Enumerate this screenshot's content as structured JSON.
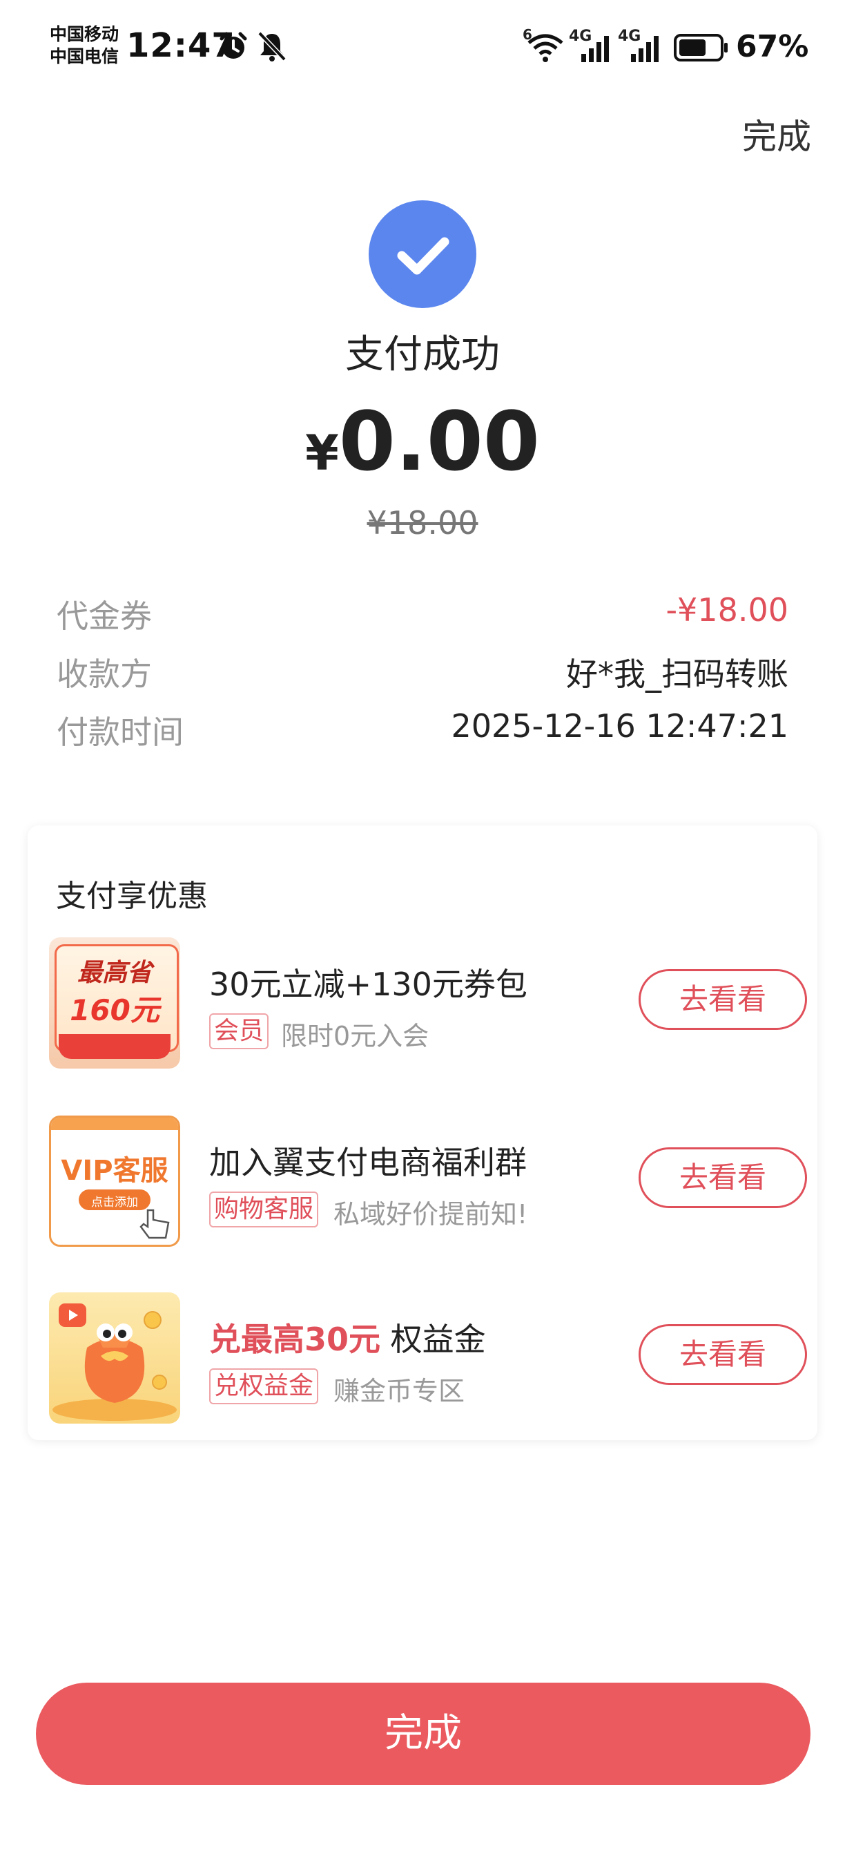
{
  "status_bar": {
    "carrier_1": "中国移动",
    "carrier_2": "中国电信",
    "time": "12:47",
    "wifi_label": "6",
    "net_label_1": "4G",
    "net_label_2": "4G",
    "battery_percent": "67%",
    "battery_level": 0.67,
    "icons": [
      "alarm-icon",
      "bell-off-icon",
      "wifi-icon",
      "signal-icon",
      "signal-icon",
      "battery-icon"
    ]
  },
  "header": {
    "done_label": "完成"
  },
  "result": {
    "status": "支付成功",
    "currency": "¥",
    "amount": "0.00",
    "original_amount": "¥18.00",
    "accent_color": "#5b86ee"
  },
  "details": [
    {
      "label": "代金券",
      "value": "-¥18.00"
    },
    {
      "label": "收款方",
      "value": "好*我_扫码转账"
    },
    {
      "label": "付款时间",
      "value": "2025-12-16 12:47:21"
    }
  ],
  "promotions": {
    "title": "支付享优惠",
    "items": [
      {
        "title": "30元立减+130元券包",
        "tag": "会员",
        "subtitle": "限时0元入会",
        "button": "去看看",
        "thumb_line1": "最高省",
        "thumb_line2": "160元"
      },
      {
        "title": "加入翼支付电商福利群",
        "tag": "购物客服",
        "subtitle": "私域好价提前知!",
        "button": "去看看",
        "thumb_line1": "VIP客服",
        "thumb_line2": "点击添加"
      },
      {
        "title_highlight": "兑最高30元",
        "title_rest": " 权益金",
        "tag": "兑权益金",
        "subtitle": "赚金币专区",
        "button": "去看看"
      }
    ]
  },
  "footer": {
    "done_button": "完成",
    "button_color": "#ea5a5f"
  }
}
